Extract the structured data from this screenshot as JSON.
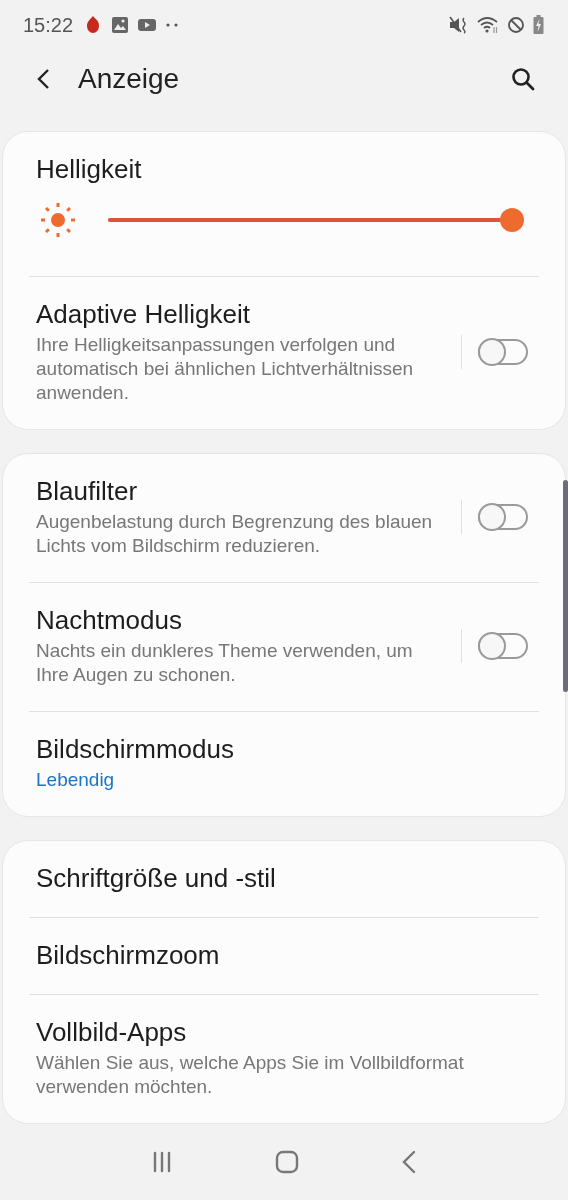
{
  "status_bar": {
    "time": "15:22"
  },
  "header": {
    "title": "Anzeige"
  },
  "sections": [
    {
      "items": [
        {
          "kind": "slider",
          "title": "Helligkeit",
          "level": 1.0
        },
        {
          "kind": "switch",
          "title": "Adaptive Helligkeit",
          "subtitle": "Ihre Helligkeitsanpassungen verfolgen und automatisch bei ähnlichen Lichtverhältnissen anwenden.",
          "on": false
        }
      ]
    },
    {
      "items": [
        {
          "kind": "switch",
          "title": "Blaufilter",
          "subtitle": "Augenbelastung durch Begrenzung des blauen Lichts vom Bildschirm reduzieren.",
          "on": false
        },
        {
          "kind": "switch",
          "title": "Nachtmodus",
          "subtitle": "Nachts ein dunkleres Theme verwenden, um Ihre Augen zu schonen.",
          "on": false
        },
        {
          "kind": "link",
          "title": "Bildschirmmodus",
          "value": "Lebendig"
        }
      ]
    },
    {
      "items": [
        {
          "kind": "link",
          "title": "Schriftgröße und -stil"
        },
        {
          "kind": "link",
          "title": "Bildschirmzoom"
        },
        {
          "kind": "link",
          "title": "Vollbild-Apps",
          "subtitle": "Wählen Sie aus, welche Apps Sie im Vollbildformat verwenden möchten."
        }
      ]
    }
  ]
}
